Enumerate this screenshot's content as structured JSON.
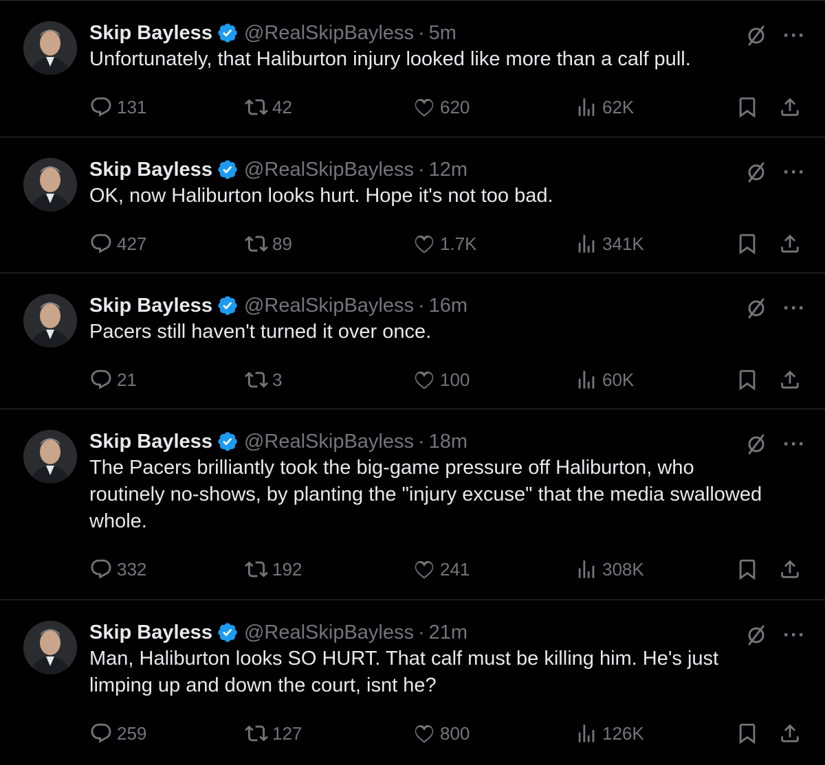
{
  "colors": {
    "background": "#000000",
    "text": "#e7e9ea",
    "muted": "#71767b",
    "verified": "#1d9bf0",
    "divider": "#2f3336"
  },
  "tweets": [
    {
      "name": "Skip Bayless",
      "handle": "@RealSkipBayless",
      "separator": "·",
      "time": "5m",
      "text": "Unfortunately, that Haliburton injury looked like more than a calf pull.",
      "replies": "131",
      "retweets": "42",
      "likes": "620",
      "views": "62K"
    },
    {
      "name": "Skip Bayless",
      "handle": "@RealSkipBayless",
      "separator": "·",
      "time": "12m",
      "text": "OK, now Haliburton looks hurt. Hope it's not too bad.",
      "replies": "427",
      "retweets": "89",
      "likes": "1.7K",
      "views": "341K"
    },
    {
      "name": "Skip Bayless",
      "handle": "@RealSkipBayless",
      "separator": "·",
      "time": "16m",
      "text": "Pacers still haven't turned it over once.",
      "replies": "21",
      "retweets": "3",
      "likes": "100",
      "views": "60K"
    },
    {
      "name": "Skip Bayless",
      "handle": "@RealSkipBayless",
      "separator": "·",
      "time": "18m",
      "text": "The Pacers brilliantly took the big-game pressure off Haliburton, who routinely no-shows, by planting the \"injury excuse\" that the media swallowed whole.",
      "replies": "332",
      "retweets": "192",
      "likes": "241",
      "views": "308K"
    },
    {
      "name": "Skip Bayless",
      "handle": "@RealSkipBayless",
      "separator": "·",
      "time": "21m",
      "text": "Man, Haliburton looks SO HURT. That calf must be killing him. He's just limping up and down the court, isnt he?",
      "replies": "259",
      "retweets": "127",
      "likes": "800",
      "views": "126K"
    }
  ],
  "icons": {
    "avatar": "avatar",
    "verified": "verified-badge-icon",
    "grok": "grok-icon",
    "more": "more-icon",
    "reply": "reply-icon",
    "retweet": "retweet-icon",
    "like": "heart-icon",
    "views": "views-icon",
    "bookmark": "bookmark-icon",
    "share": "share-icon"
  },
  "more_glyph": "···"
}
